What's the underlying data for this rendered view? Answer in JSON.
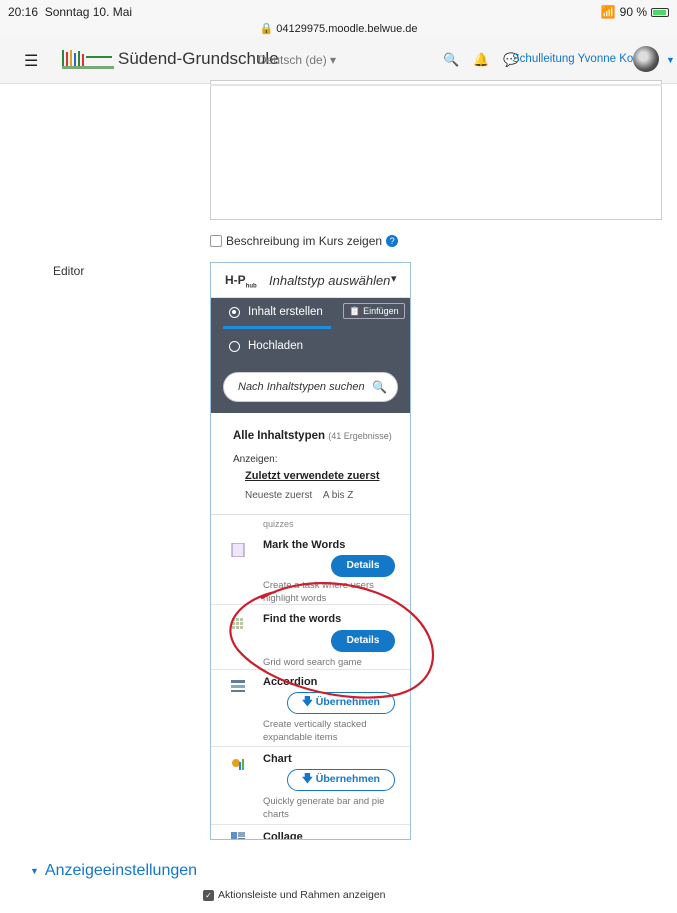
{
  "statusbar": {
    "time": "20:16",
    "date": "Sonntag 10. Mai",
    "url": "04129975.moodle.belwue.de",
    "battery": "90 %"
  },
  "navbar": {
    "menu_icon": "hamburger-icon",
    "site_name": "Südend-Grundschule",
    "language": "Deutsch (de)",
    "user_name": "Schulleitung Yvonne Kopf"
  },
  "description": {
    "show_in_course_label": "Beschreibung im Kurs zeigen"
  },
  "editor": {
    "label": "Editor",
    "h5p_logo": "H-P",
    "hub_title": "Inhaltstyp auswählen",
    "tabs": {
      "create": "Inhalt erstellen",
      "upload": "Hochladen"
    },
    "paste_button": "Einfügen",
    "search_placeholder": "Nach Inhaltstypen suchen",
    "all_types": "Alle Inhaltstypen",
    "result_count": "(41 Ergebnisse)",
    "show_label": "Anzeigen:",
    "sort_recent": "Zuletzt verwendete zuerst",
    "sort_newest": "Neueste zuerst",
    "sort_az": "A bis Z",
    "fragment": "quizzes",
    "items": [
      {
        "name": "Mark the Words",
        "desc": "Create a task where users highlight words",
        "button": "Details"
      },
      {
        "name": "Find the words",
        "desc": "Grid word search game",
        "button": "Details"
      },
      {
        "name": "Accordion",
        "desc": "Create vertically stacked expandable items",
        "button": "Übernehmen"
      },
      {
        "name": "Chart",
        "desc": "Quickly generate bar and pie charts",
        "button": "Übernehmen"
      },
      {
        "name": "Collage",
        "desc": "",
        "button": ""
      }
    ]
  },
  "display_settings": {
    "title": "Anzeigeeinstellungen",
    "toolbar_checkbox": "Aktionsleiste und Rahmen anzeigen"
  },
  "colors": {
    "accent": "#1177d1",
    "hub_dark": "#4d5562",
    "button": "#1478c8",
    "annotation": "#cc1e2b"
  }
}
